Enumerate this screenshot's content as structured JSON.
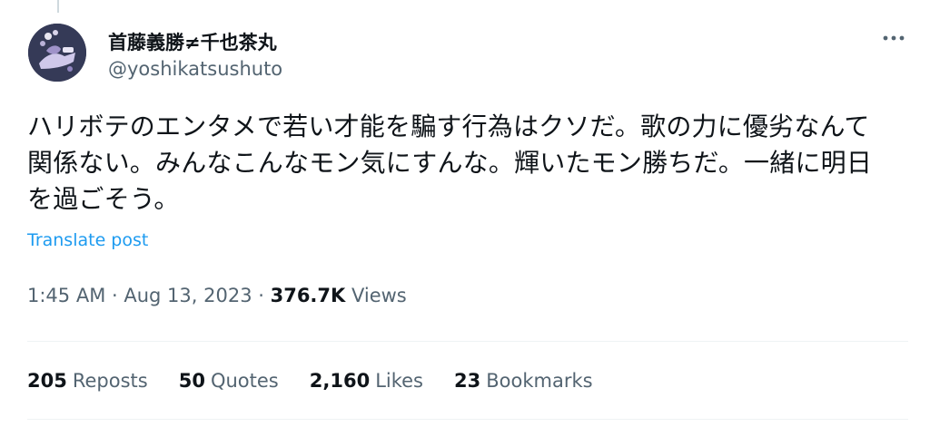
{
  "author": {
    "display_name": "首藤義勝≠千也茶丸",
    "handle": "@yoshikatsushuto"
  },
  "tweet": {
    "text_lines": [
      "ハリボテのエンタメで若い才能を騙す行為はクソだ。歌の力に優劣なんて",
      "関係ない。みんなこんなモン気にすんな。輝いたモン勝ちだ。一緒に明日",
      "を過ごそう。"
    ],
    "translate_label": "Translate post"
  },
  "meta": {
    "time": "1:45 AM",
    "sep1": " · ",
    "date": "Aug 13, 2023",
    "sep2": " · ",
    "views_count": "376.7K",
    "views_label": " Views"
  },
  "stats": {
    "reposts_count": "205",
    "reposts_label": "Reposts",
    "quotes_count": "50",
    "quotes_label": "Quotes",
    "likes_count": "2,160",
    "likes_label": "Likes",
    "bookmarks_count": "23",
    "bookmarks_label": "Bookmarks"
  },
  "icons": {
    "more": "more-horizontal-icon",
    "avatar": "avatar-image"
  },
  "colors": {
    "text": "#0f1419",
    "secondary": "#536471",
    "link": "#1d9bf0",
    "divider": "#eff3f4",
    "avatar_bg": "#353a57"
  }
}
